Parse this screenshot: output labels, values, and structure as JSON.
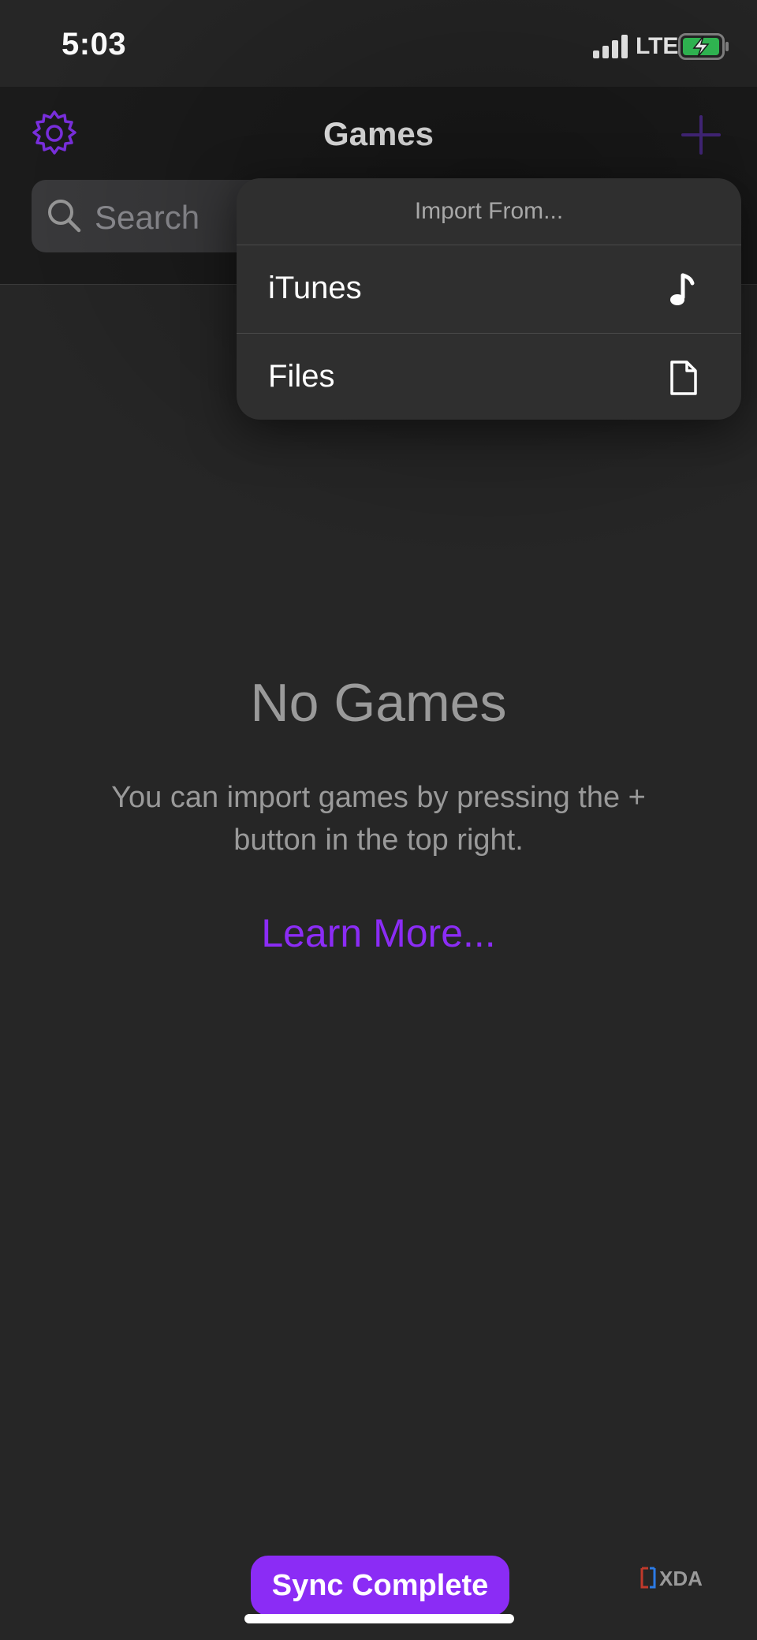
{
  "status_bar": {
    "time": "5:03",
    "network": "LTE",
    "signal_icon": "signal-bars-icon",
    "battery_icon": "battery-charging-icon",
    "battery_color": "#34c759"
  },
  "nav": {
    "title": "Games",
    "settings_icon": "gear-icon",
    "add_icon": "plus-icon"
  },
  "search": {
    "placeholder": "Search",
    "icon": "search-icon"
  },
  "import_menu": {
    "header": "Import From...",
    "items": [
      {
        "label": "iTunes",
        "icon": "music-note-icon"
      },
      {
        "label": "Files",
        "icon": "document-icon"
      }
    ]
  },
  "empty_state": {
    "title": "No Games",
    "body": "You can import games by pressing the + button in the top right.",
    "link": "Learn More..."
  },
  "toast": {
    "label": "Sync Complete"
  },
  "watermark": {
    "text": "XDA"
  },
  "colors": {
    "accent": "#8b2cf5",
    "background": "#262626",
    "menu_background": "#2f2f2f"
  }
}
